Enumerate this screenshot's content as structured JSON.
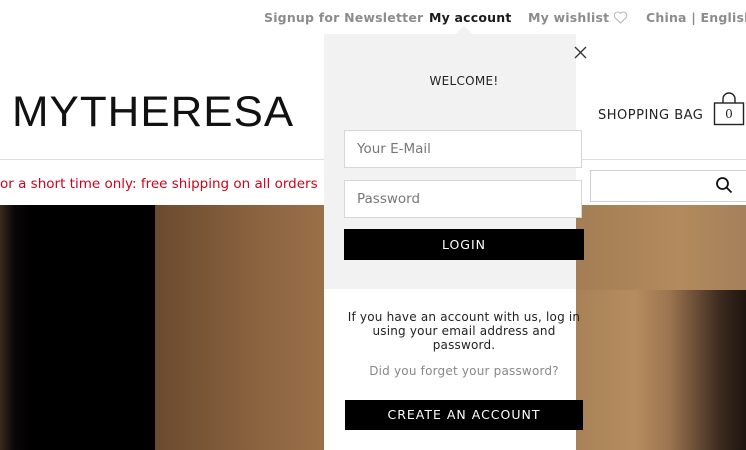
{
  "topnav": {
    "newsletter": "Signup for Newsletter",
    "account": "My account",
    "wishlist": "My wishlist",
    "region": "China | English"
  },
  "header": {
    "logo": "MYTHERESA",
    "bag_label": "SHOPPING BAG",
    "bag_count": "0"
  },
  "promo": "or a short time only: free shipping on all orders",
  "search": {
    "placeholder": ""
  },
  "login_panel": {
    "welcome": "WELCOME!",
    "email_placeholder": "Your E-Mail",
    "password_placeholder": "Password",
    "login_label": "LOGIN",
    "info": "If you have an account with us, log in using your email address and password.",
    "forgot": "Did you forget your password?",
    "create_label": "CREATE AN ACCOUNT"
  },
  "colors": {
    "promo": "#d0021b",
    "panel_bg": "#f2f2f2",
    "button": "#000000"
  }
}
